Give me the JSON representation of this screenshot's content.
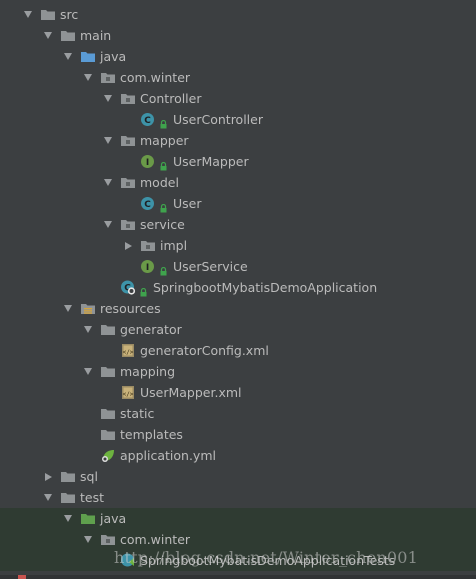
{
  "tree": [
    {
      "label": "src",
      "indent": 0,
      "arrow": "down",
      "icon": "folder-icon",
      "name": "tree-item-src"
    },
    {
      "label": "main",
      "indent": 1,
      "arrow": "down",
      "icon": "folder-icon",
      "name": "tree-item-main"
    },
    {
      "label": "java",
      "indent": 2,
      "arrow": "down",
      "icon": "source-folder-icon",
      "name": "tree-item-main-java"
    },
    {
      "label": "com.winter",
      "indent": 3,
      "arrow": "down",
      "icon": "package-icon",
      "name": "tree-item-com-winter"
    },
    {
      "label": "Controller",
      "indent": 4,
      "arrow": "down",
      "icon": "package-icon",
      "name": "tree-item-controller"
    },
    {
      "label": "UserController",
      "indent": 5,
      "arrow": "none",
      "icon": "class-icon",
      "lock": true,
      "name": "tree-item-user-controller"
    },
    {
      "label": "mapper",
      "indent": 4,
      "arrow": "down",
      "icon": "package-icon",
      "name": "tree-item-mapper"
    },
    {
      "label": "UserMapper",
      "indent": 5,
      "arrow": "none",
      "icon": "interface-icon",
      "lock": true,
      "name": "tree-item-user-mapper"
    },
    {
      "label": "model",
      "indent": 4,
      "arrow": "down",
      "icon": "package-icon",
      "name": "tree-item-model"
    },
    {
      "label": "User",
      "indent": 5,
      "arrow": "none",
      "icon": "class-icon",
      "lock": true,
      "name": "tree-item-user"
    },
    {
      "label": "service",
      "indent": 4,
      "arrow": "down",
      "icon": "package-icon",
      "name": "tree-item-service"
    },
    {
      "label": "impl",
      "indent": 5,
      "arrow": "right",
      "icon": "package-icon",
      "name": "tree-item-impl"
    },
    {
      "label": "UserService",
      "indent": 5,
      "arrow": "none",
      "icon": "interface-icon",
      "lock": true,
      "name": "tree-item-user-service"
    },
    {
      "label": "SpringbootMybatisDemoApplication",
      "indent": 4,
      "arrow": "none",
      "icon": "spring-boot-class-icon",
      "lock": true,
      "name": "tree-item-demo-application"
    },
    {
      "label": "resources",
      "indent": 2,
      "arrow": "down",
      "icon": "resources-folder-icon",
      "name": "tree-item-resources"
    },
    {
      "label": "generator",
      "indent": 3,
      "arrow": "down",
      "icon": "folder-icon",
      "name": "tree-item-generator"
    },
    {
      "label": "generatorConfig.xml",
      "indent": 4,
      "arrow": "none",
      "icon": "xml-file-icon",
      "name": "tree-item-generator-config"
    },
    {
      "label": "mapping",
      "indent": 3,
      "arrow": "down",
      "icon": "folder-icon",
      "name": "tree-item-mapping"
    },
    {
      "label": "UserMapper.xml",
      "indent": 4,
      "arrow": "none",
      "icon": "xml-file-icon",
      "name": "tree-item-user-mapper-xml"
    },
    {
      "label": "static",
      "indent": 3,
      "arrow": "none",
      "icon": "folder-icon",
      "name": "tree-item-static"
    },
    {
      "label": "templates",
      "indent": 3,
      "arrow": "none",
      "icon": "folder-icon",
      "name": "tree-item-templates"
    },
    {
      "label": "application.yml",
      "indent": 3,
      "arrow": "none",
      "icon": "spring-yml-icon",
      "name": "tree-item-application-yml"
    },
    {
      "label": "sql",
      "indent": 1,
      "arrow": "right",
      "icon": "folder-icon",
      "name": "tree-item-sql"
    },
    {
      "label": "test",
      "indent": 1,
      "arrow": "down",
      "icon": "folder-icon",
      "name": "tree-item-test"
    },
    {
      "label": "java",
      "indent": 2,
      "arrow": "down",
      "icon": "test-source-folder-icon",
      "tint": true,
      "name": "tree-item-test-java"
    },
    {
      "label": "com.winter",
      "indent": 3,
      "arrow": "down",
      "icon": "package-icon",
      "tint": true,
      "name": "tree-item-test-com-winter"
    },
    {
      "label": "SpringbootMybatisDemoApplicationTests",
      "indent": 4,
      "arrow": "none",
      "icon": "test-class-icon",
      "tint": true,
      "name": "tree-item-demo-application-tests"
    }
  ],
  "watermark": "http://blog.csdn.net/Winter_chen001",
  "colors": {
    "background": "#3c3f41",
    "text": "#bbbbbb",
    "folder": "#8f9395",
    "source_folder": "#5b9bd5",
    "class": "#3d93a8",
    "interface": "#6a9a48",
    "lock": "#3fa34d",
    "test_tint": "#2f3b32"
  }
}
